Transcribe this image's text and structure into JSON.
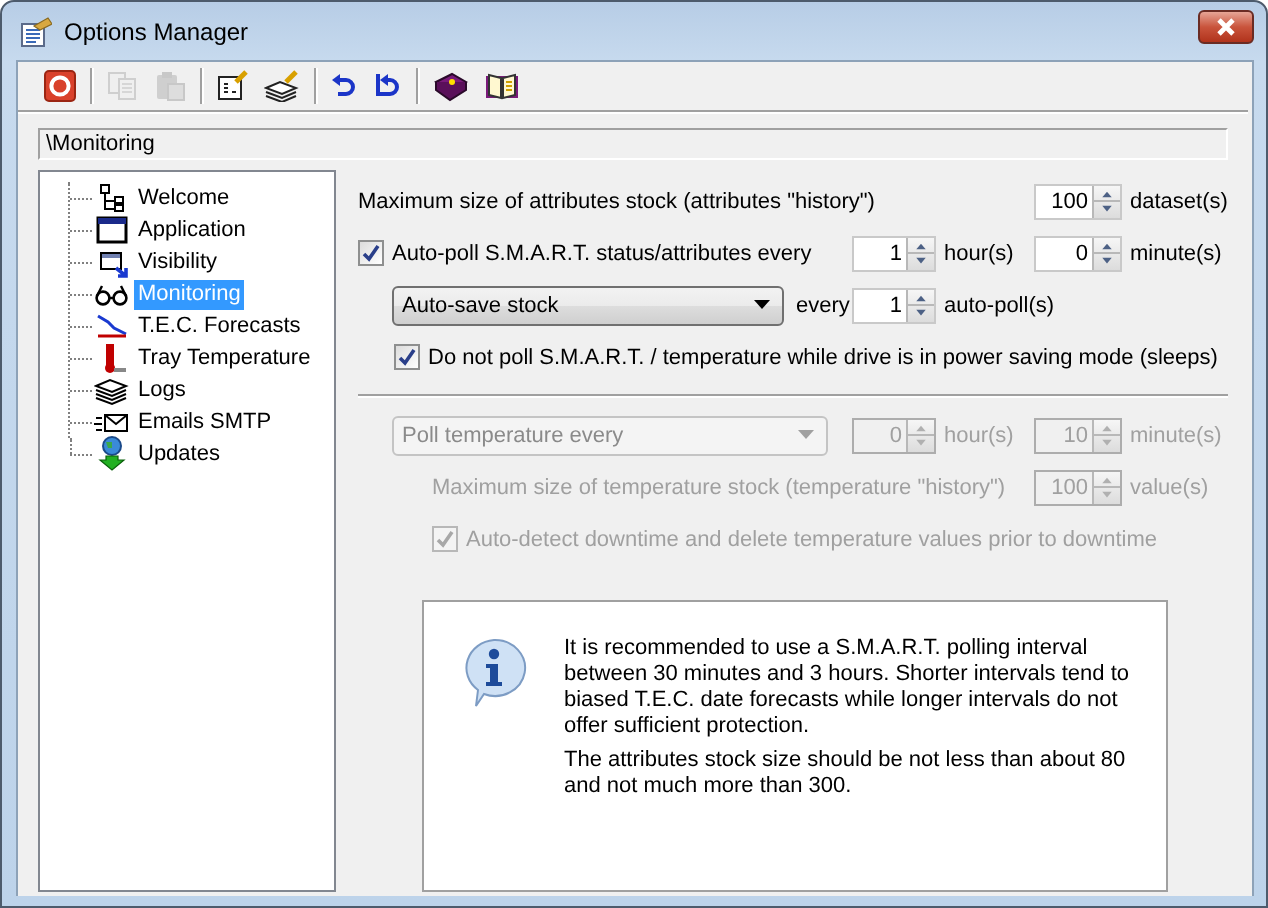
{
  "window": {
    "title": "Options Manager"
  },
  "toolbar": {
    "groups": [
      {
        "buttons": [
          {
            "kind": "power",
            "disabled": false
          }
        ]
      },
      {
        "buttons": [
          {
            "kind": "copy",
            "disabled": true
          },
          {
            "kind": "paste",
            "disabled": true
          }
        ]
      },
      {
        "buttons": [
          {
            "kind": "note",
            "disabled": false
          },
          {
            "kind": "stack",
            "disabled": false
          }
        ]
      },
      {
        "buttons": [
          {
            "kind": "undo",
            "disabled": false
          },
          {
            "kind": "redo",
            "disabled": false
          }
        ]
      },
      {
        "buttons": [
          {
            "kind": "book",
            "disabled": false
          },
          {
            "kind": "openbook",
            "disabled": false
          }
        ]
      }
    ]
  },
  "path": "\\Monitoring",
  "tree": {
    "items": [
      {
        "label": "Welcome",
        "kind": "hierarchy",
        "selected": false
      },
      {
        "label": "Application",
        "kind": "window",
        "selected": false
      },
      {
        "label": "Visibility",
        "kind": "visibility",
        "selected": false
      },
      {
        "label": "Monitoring",
        "kind": "glasses",
        "selected": true
      },
      {
        "label": "T.E.C. Forecasts",
        "kind": "chart",
        "selected": false
      },
      {
        "label": "Tray Temperature",
        "kind": "thermometer",
        "selected": false
      },
      {
        "label": "Logs",
        "kind": "stack",
        "selected": false
      },
      {
        "label": "Emails SMTP",
        "kind": "envelope",
        "selected": false
      },
      {
        "label": "Updates",
        "kind": "globe",
        "selected": false
      }
    ]
  },
  "monitoring": {
    "history": {
      "label": "Maximum size of attributes stock (attributes \"history\")",
      "value": "100",
      "unit": "dataset(s)"
    },
    "auto_poll": {
      "label": "Auto-poll S.M.A.R.T. status/attributes every",
      "checked": true,
      "hours": "1",
      "hours_unit": "hour(s)",
      "minutes": "0",
      "minutes_unit": "minute(s)"
    },
    "auto_save": {
      "value": "Auto-save stock",
      "every": "every",
      "count": "1",
      "unit": "auto-poll(s)"
    },
    "no_sleep_poll": {
      "label": "Do not poll S.M.A.R.T. / temperature while drive is in power saving mode (sleeps)",
      "checked": true
    }
  },
  "temperature": {
    "disabled": true,
    "mode": "Poll temperature every",
    "hours": "0",
    "hours_unit": "hour(s)",
    "minutes": "10",
    "minutes_unit": "minute(s)",
    "history_label": "Maximum size of temperature stock (temperature \"history\")",
    "history_value": "100",
    "history_unit": "value(s)",
    "auto_detect": {
      "label": "Auto-detect downtime and delete temperature values prior to downtime",
      "checked": true
    }
  },
  "info": {
    "paragraphs": [
      "It is recommended to use a S.M.A.R.T. polling interval between 30 minutes and 3 hours. Shorter intervals tend to biased T.E.C. date forecasts while longer intervals do not offer sufficient protection.",
      "The attributes stock size should be not less than about 80 and not much more than 300."
    ]
  }
}
